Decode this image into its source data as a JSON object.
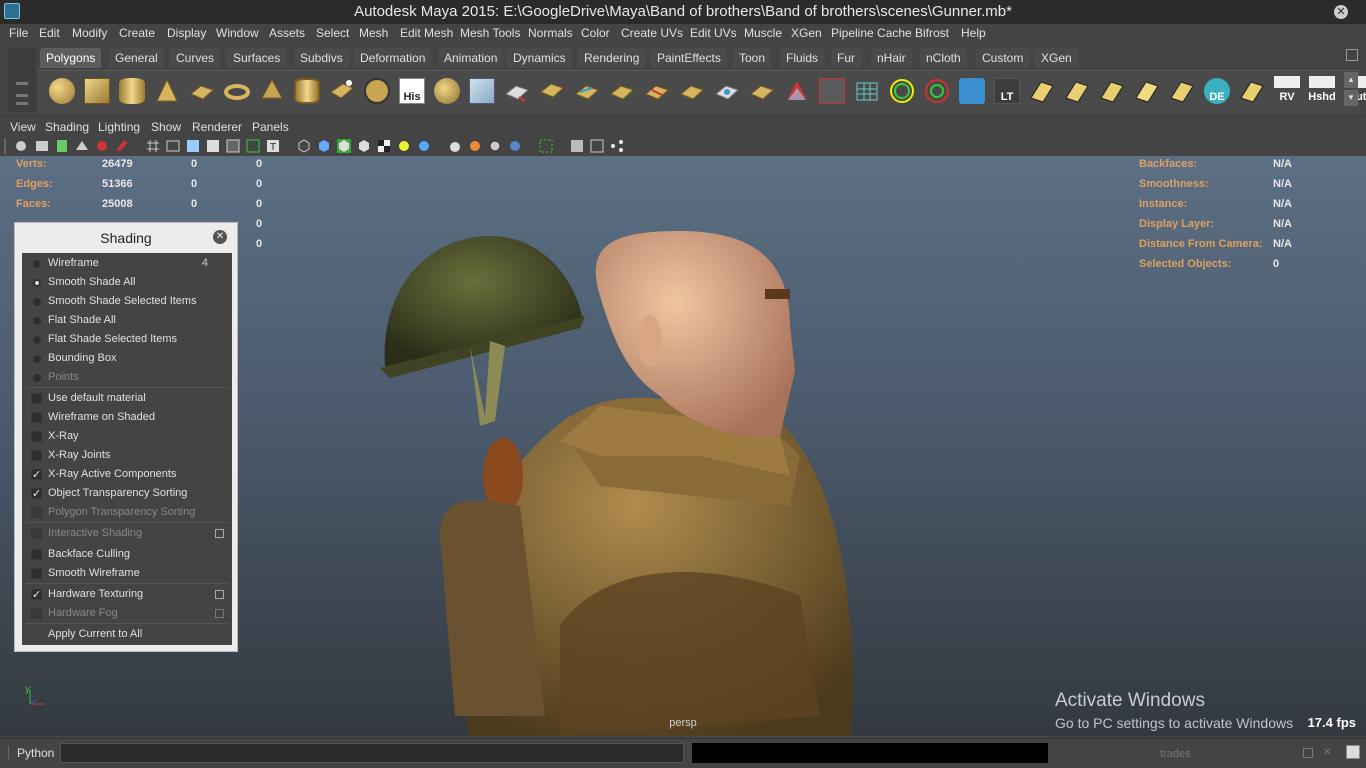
{
  "title": "Autodesk Maya 2015: E:\\GoogleDrive\\Maya\\Band of brothers\\Band of brothers\\scenes\\Gunner.mb*",
  "main_menu": [
    "File",
    "Edit",
    "Modify",
    "Create",
    "Display",
    "Window",
    "Assets",
    "Select",
    "Mesh",
    "Edit Mesh",
    "Mesh Tools",
    "Normals",
    "Color",
    "Create UVs",
    "Edit UVs",
    "Muscle",
    "XGen",
    "Pipeline Cache",
    "Bifrost",
    "Help"
  ],
  "shelf_tabs": [
    "Polygons",
    "General",
    "Curves",
    "Surfaces",
    "Subdivs",
    "Deformation",
    "Animation",
    "Dynamics",
    "Rendering",
    "PaintEffects",
    "Toon",
    "Fluids",
    "Fur",
    "nHair",
    "nCloth",
    "Custom",
    "XGen"
  ],
  "shelf_labels": {
    "his": "His",
    "lt": "LT",
    "de": "DE",
    "rv": "RV",
    "hshd": "Hshd",
    "out": "Out"
  },
  "panel_menu": [
    "View",
    "Shading",
    "Lighting",
    "Show",
    "Renderer",
    "Panels"
  ],
  "hud_left": [
    {
      "label": "Verts:",
      "v1": "26479",
      "v2": "0",
      "v3": "0"
    },
    {
      "label": "Edges:",
      "v1": "51366",
      "v2": "0",
      "v3": "0"
    },
    {
      "label": "Faces:",
      "v1": "25008",
      "v2": "0",
      "v3": "0"
    },
    {
      "label": "",
      "v1": "",
      "v2": "",
      "v3": "0"
    },
    {
      "label": "",
      "v1": "",
      "v2": "",
      "v3": "0"
    }
  ],
  "hud_right": [
    {
      "label": "Backfaces:",
      "value": "N/A"
    },
    {
      "label": "Smoothness:",
      "value": "N/A"
    },
    {
      "label": "Instance:",
      "value": "N/A"
    },
    {
      "label": "Display Layer:",
      "value": "N/A"
    },
    {
      "label": "Distance From Camera:",
      "value": "N/A"
    },
    {
      "label": "Selected Objects:",
      "value": "0"
    }
  ],
  "shading": {
    "title": "Shading",
    "wireframe": "Wireframe",
    "wireframe_count": "4",
    "smooth_all": "Smooth Shade All",
    "smooth_selected": "Smooth Shade Selected Items",
    "flat_all": "Flat Shade All",
    "flat_selected": "Flat Shade Selected Items",
    "bounding_box": "Bounding Box",
    "points": "Points",
    "default_material": "Use default material",
    "wireframe_on_shaded": "Wireframe on Shaded",
    "xray": "X-Ray",
    "xray_joints": "X-Ray Joints",
    "xray_active": "X-Ray Active Components",
    "object_transparency": "Object Transparency Sorting",
    "polygon_transparency": "Polygon Transparency Sorting",
    "interactive_shading": "Interactive Shading",
    "backface_culling": "Backface Culling",
    "smooth_wireframe": "Smooth Wireframe",
    "hardware_texturing": "Hardware Texturing",
    "hardware_fog": "Hardware Fog",
    "apply_all": "Apply Current to All"
  },
  "viewport": {
    "camera": "persp",
    "fps": "17.4 fps",
    "activate_title": "Activate Windows",
    "activate_sub": "Go to PC settings to activate Windows",
    "axis_y": "y"
  },
  "cmd": {
    "language": "Python",
    "right_label": "trades"
  }
}
